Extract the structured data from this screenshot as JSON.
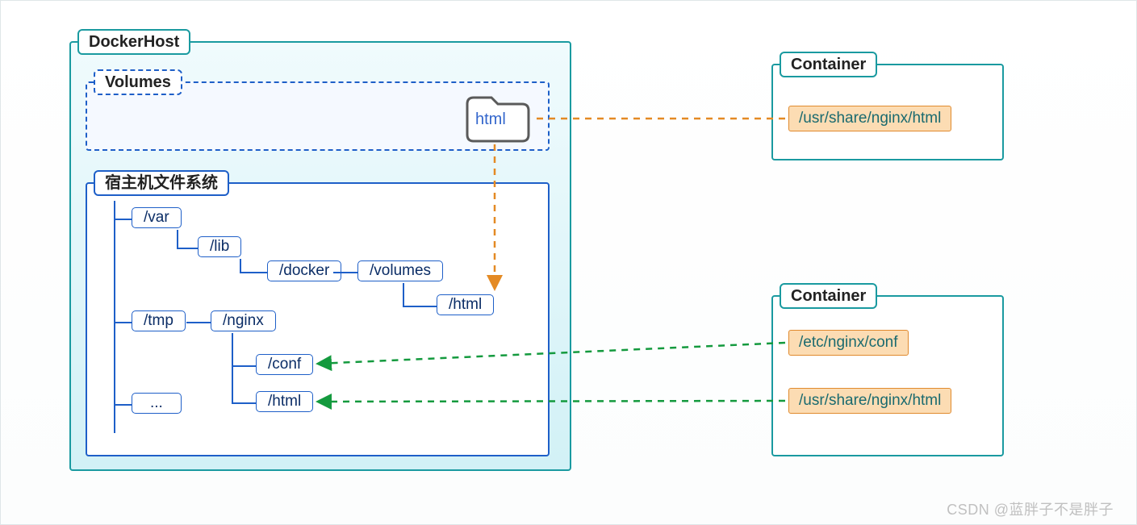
{
  "dockerHost": {
    "title": "DockerHost",
    "volumes": {
      "title": "Volumes",
      "folder_label": "html"
    },
    "hostfs": {
      "title": "宿主机文件系统",
      "nodes": {
        "var": "/var",
        "lib": "/lib",
        "docker": "/docker",
        "volumes": "/volumes",
        "html_vol": "/html",
        "tmp": "/tmp",
        "nginx": "/nginx",
        "conf": "/conf",
        "html_nginx": "/html",
        "ellipsis": "..."
      }
    }
  },
  "container1": {
    "title": "Container",
    "path1": "/usr/share/nginx/html"
  },
  "container2": {
    "title": "Container",
    "path1": "/etc/nginx/conf",
    "path2": "/usr/share/nginx/html"
  },
  "watermark": "CSDN @蓝胖子不是胖子",
  "colors": {
    "teal": "#1a9aa0",
    "blue": "#1e5fc8",
    "orange": "#e48a24",
    "green": "#149a3e"
  }
}
